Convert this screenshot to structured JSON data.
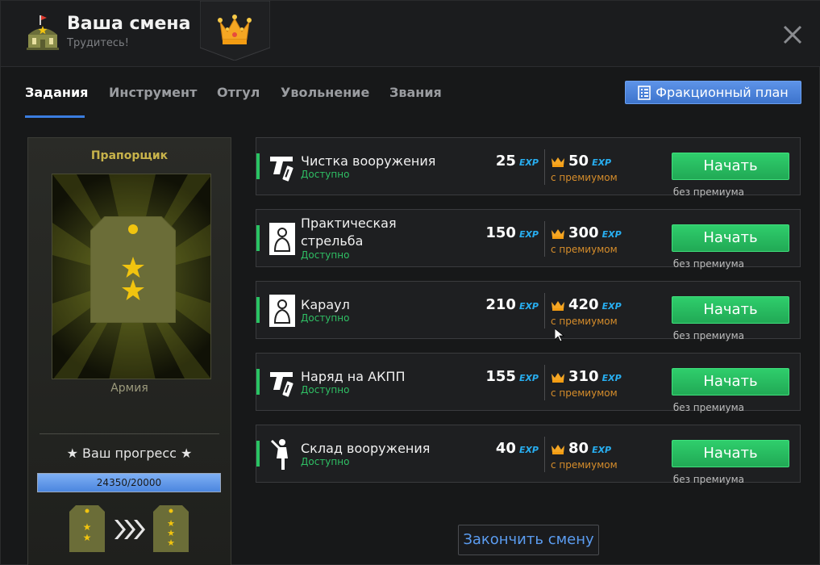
{
  "header": {
    "title": "Ваша смена",
    "subtitle": "Трудитесь!",
    "hq_icon": "hq-building-icon",
    "premium_icon": "crown-icon",
    "close_icon": "close-icon"
  },
  "tabs": [
    {
      "label": "Задания",
      "active": true
    },
    {
      "label": "Инструмент",
      "active": false
    },
    {
      "label": "Отгул",
      "active": false
    },
    {
      "label": "Увольнение",
      "active": false
    },
    {
      "label": "Звания",
      "active": false
    }
  ],
  "plan_button": {
    "label": "Фракционный план",
    "icon": "checklist-icon"
  },
  "rank_panel": {
    "rank_name": "Прапорщик",
    "faction": "Армия",
    "progress_title": "★ Ваш прогресс ★",
    "progress_value": 24350,
    "progress_max": 20000,
    "progress_text": "24350/20000",
    "progress_fraction": 1.0
  },
  "tasks": [
    {
      "title": "Чистка вооружения",
      "status": "Доступно",
      "icon": "pistol-icon",
      "base": "25",
      "premium": "50",
      "two_line": false
    },
    {
      "title": "Практическая стрельба",
      "status": "Доступно",
      "icon": "target-icon",
      "base": "150",
      "premium": "300",
      "two_line": true
    },
    {
      "title": "Караул",
      "status": "Доступно",
      "icon": "target-icon",
      "base": "210",
      "premium": "420",
      "two_line": false
    },
    {
      "title": "Наряд на АКПП",
      "status": "Доступно",
      "icon": "pistol-icon",
      "base": "155",
      "premium": "310",
      "two_line": false
    },
    {
      "title": "Склад вооружения",
      "status": "Доступно",
      "icon": "soldier-icon",
      "base": "40",
      "premium": "80",
      "two_line": false
    }
  ],
  "labels": {
    "exp": "EXP",
    "base_sub": "без премиума",
    "premium_sub": "с премиумом",
    "start": "Начать"
  },
  "finish_button": "Закончить смену",
  "colors": {
    "accent_blue": "#3a7de0",
    "start_green": "#29c363",
    "exp_blue": "#28aef0",
    "premium_orange": "#d68d2b",
    "rank_gold": "#c8b34a"
  }
}
